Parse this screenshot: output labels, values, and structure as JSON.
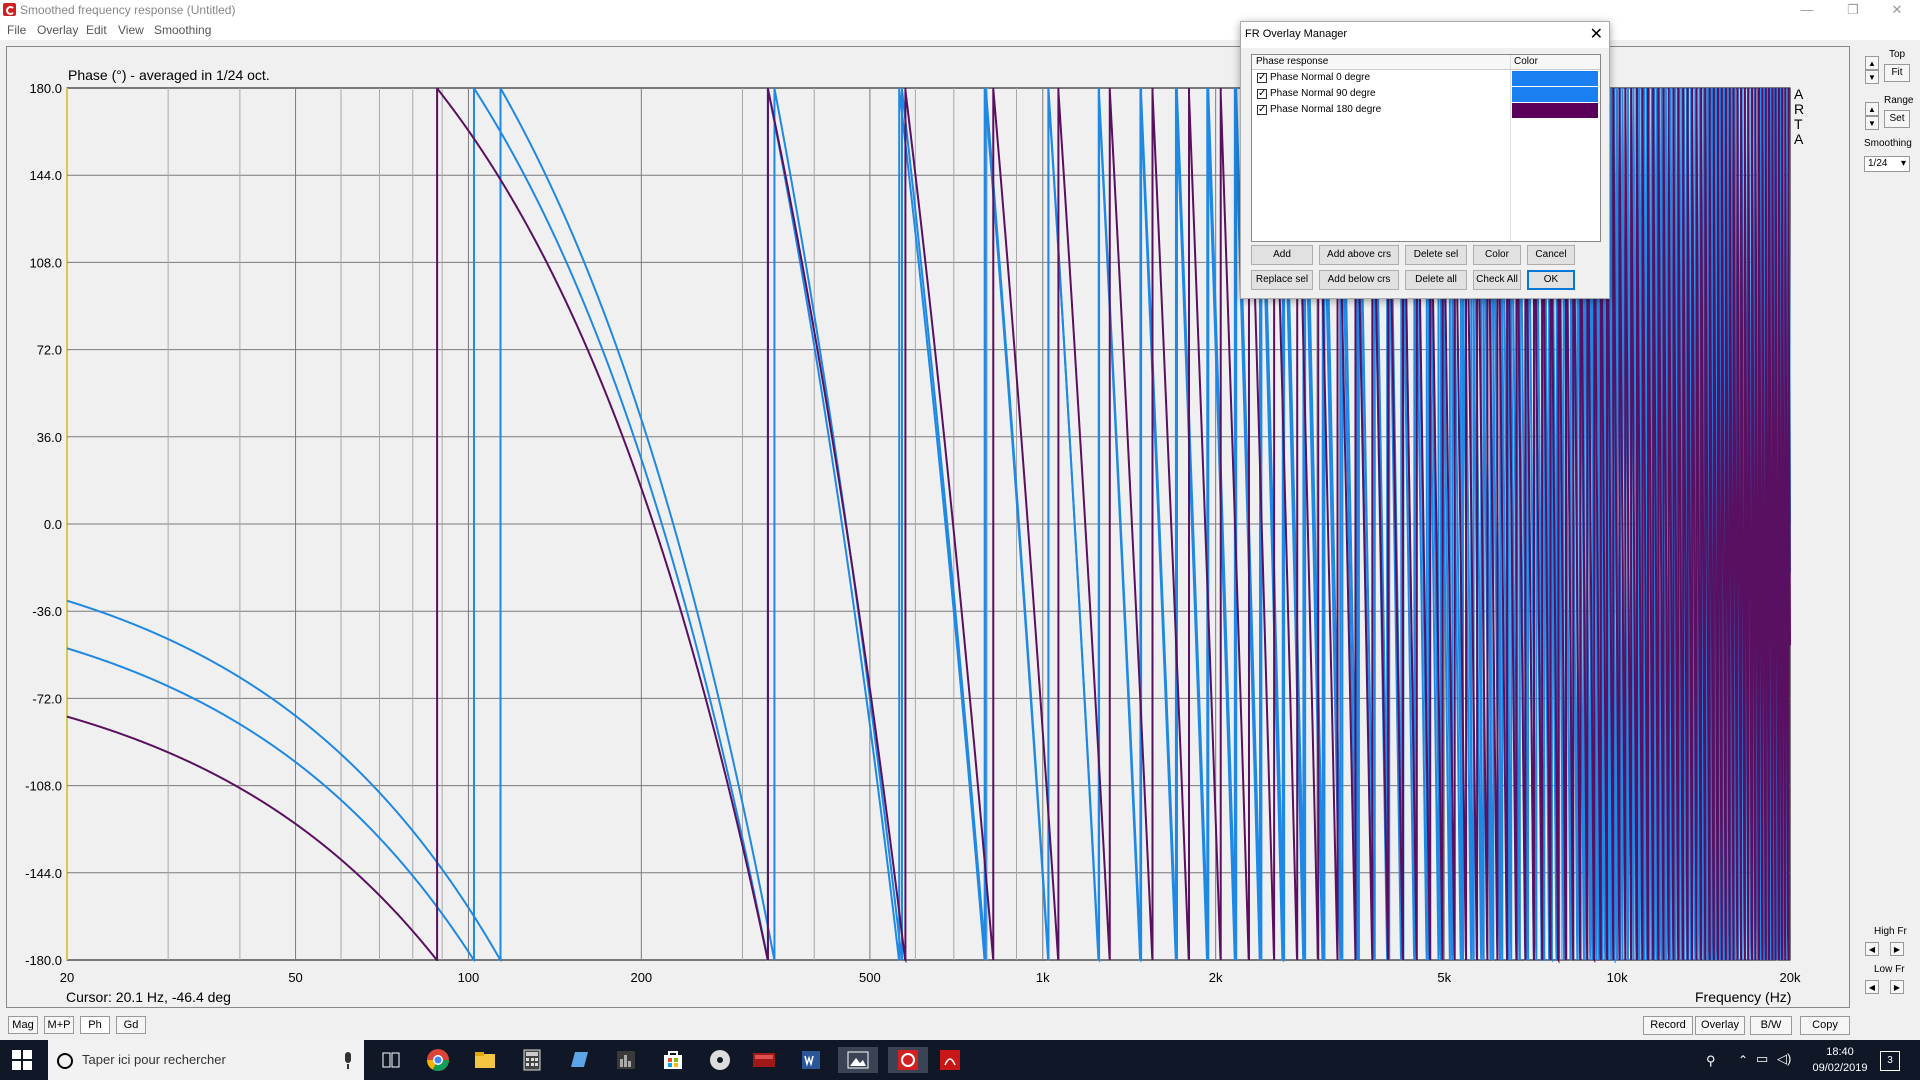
{
  "window": {
    "title": "Smoothed frequency response (Untitled)",
    "controls": [
      "—",
      "❐",
      "✕"
    ]
  },
  "menu": [
    "File",
    "Overlay",
    "Edit",
    "View",
    "Smoothing"
  ],
  "plot": {
    "title": "Phase (°) - averaged in 1/24 oct.",
    "y_ticks": [
      "180.0",
      "144.0",
      "108.0",
      "72.0",
      "36.0",
      "0.0",
      "-36.0",
      "-72.0",
      "-108.0",
      "-144.0",
      "-180.0"
    ],
    "x_ticks": [
      "20",
      "50",
      "100",
      "200",
      "500",
      "1k",
      "2k",
      "5k",
      "10k",
      "20k"
    ],
    "x_label": "Frequency (Hz)",
    "cursor": "Cursor: 20.1 Hz, -46.4 deg",
    "arta_letters": [
      "A",
      "R",
      "T",
      "A"
    ],
    "colors": {
      "blue": "#1e88e5",
      "purple": "#5a1060",
      "grid": "#7a7a7a",
      "bg": "#f0f0f0"
    }
  },
  "chart_data": {
    "type": "line",
    "title": "Phase (°) - averaged in 1/24 oct.",
    "xlabel": "Frequency (Hz)",
    "ylabel": "",
    "xscale": "log",
    "xlim": [
      20,
      20000
    ],
    "ylim": [
      -180,
      180
    ],
    "grid": true,
    "series": [
      {
        "name": "Phase Normal 0 degre",
        "color": "#1e88e5",
        "start_phase": 0,
        "delay_ms": 4.4
      },
      {
        "name": "Phase Normal 90 degre",
        "color": "#1e88e5",
        "start_phase": -20,
        "delay_ms": 4.35
      },
      {
        "name": "Phase Normal 180 degre",
        "color": "#5a1060",
        "start_phase": -50,
        "delay_ms": 4.1
      }
    ]
  },
  "right_panel": {
    "top_label": "Top",
    "fit_label": "Fit",
    "range_label": "Range",
    "set_label": "Set",
    "smoothing_label": "Smoothing",
    "smoothing_value": "1/24",
    "high_fr_label": "High Fr",
    "low_fr_label": "Low Fr"
  },
  "bottom_tabs": [
    "Mag",
    "M+P",
    "Ph",
    "Gd"
  ],
  "bottom_buttons": [
    "Record",
    "Overlay",
    "B/W",
    "Copy"
  ],
  "dialog": {
    "title": "FR Overlay Manager",
    "col_name": "Phase response",
    "col_color": "Color",
    "rows": [
      {
        "label": "Phase Normal 0 degre",
        "color": "#1a7ff0",
        "checked": true
      },
      {
        "label": "Phase Normal 90 degre",
        "color": "#1a7ff0",
        "checked": true
      },
      {
        "label": "Phase Normal 180 degre",
        "color": "#5a005a",
        "checked": true
      }
    ],
    "buttons_row1": [
      "Add",
      "Add above crs",
      "Delete sel",
      "Color",
      "Cancel"
    ],
    "buttons_row2": [
      "Replace sel",
      "Add below crs",
      "Delete all",
      "Check All",
      "OK"
    ]
  },
  "taskbar": {
    "search_placeholder": "Taper ici pour rechercher",
    "time": "18:40",
    "date": "09/02/2019",
    "notification_count": "3"
  }
}
